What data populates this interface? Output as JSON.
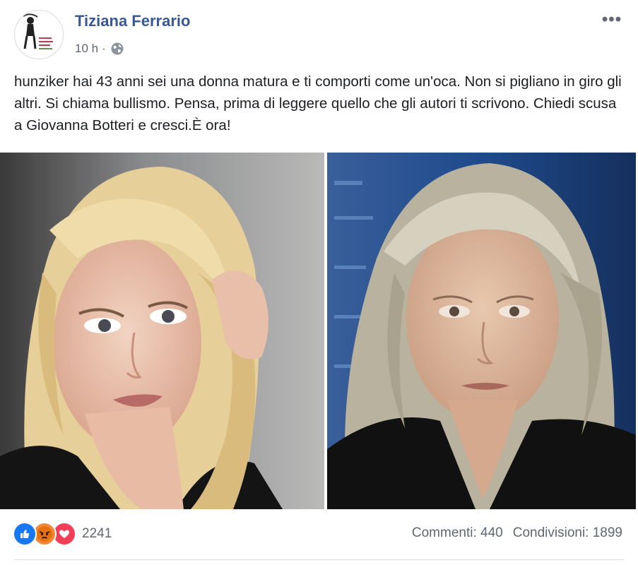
{
  "post": {
    "author": "Tiziana Ferrario",
    "time": "10 h",
    "separator": "·",
    "text": "hunziker hai 43 anni sei una donna matura e ti comporti come un'oca. Non si pigliano in giro gli altri. Si chiama bullismo. Pensa, prima di leggere quello che gli autori ti scrivono. Chiedi scusa a Giovanna Botteri e cresci.È ora!",
    "more_label": "•••",
    "privacy_icon": "globe-icon"
  },
  "reactions": {
    "icons": [
      "like-reaction-icon",
      "angry-reaction-icon",
      "love-reaction-icon"
    ],
    "count": "2241"
  },
  "stats": {
    "comments": "Commenti: 440",
    "shares": "Condivisioni: 1899"
  },
  "colors": {
    "author_link": "#385898",
    "meta_text": "#606770",
    "like": "#1877f2",
    "angry": "#f0883a",
    "love": "#f33e58"
  }
}
